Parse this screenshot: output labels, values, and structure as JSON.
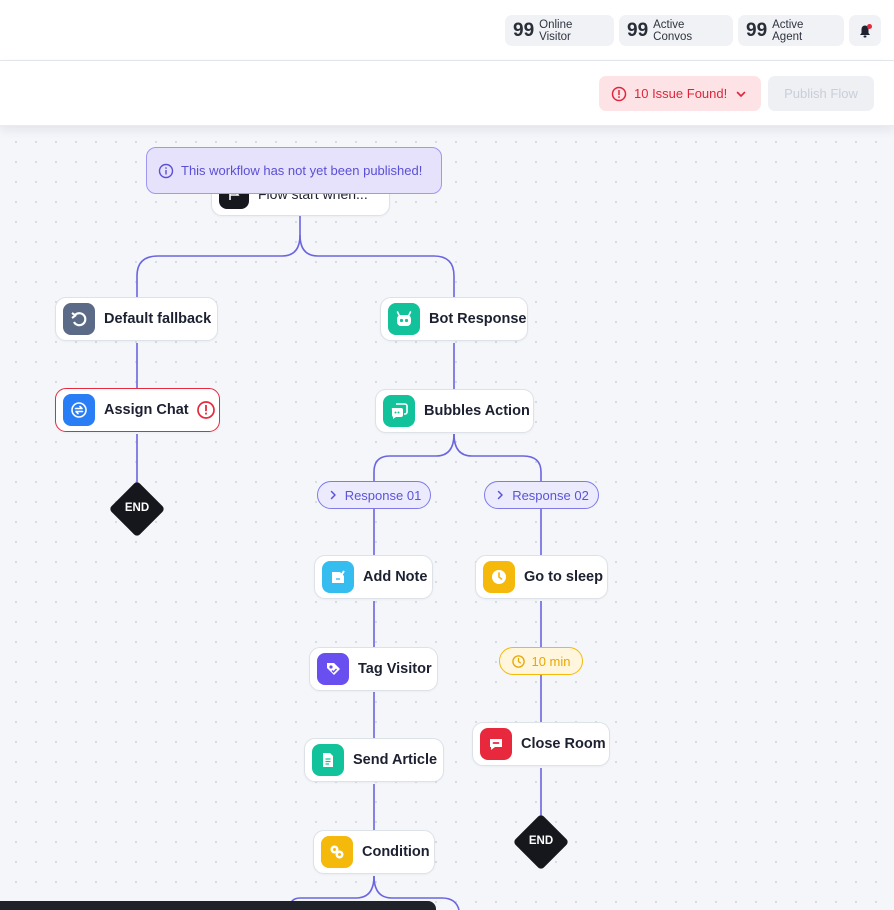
{
  "header": {
    "stats": [
      {
        "value": "99",
        "label": "Online Visitor"
      },
      {
        "value": "99",
        "label": "Active Convos"
      },
      {
        "value": "99",
        "label": "Active Agent"
      }
    ],
    "bell_icon": "bell-icon"
  },
  "toolbar": {
    "issues_label": "10 Issue Found!",
    "publish_label": "Publish Flow"
  },
  "flow": {
    "banner": "This workflow has not yet been published!",
    "start_label": "Flow start when...",
    "nodes": {
      "default_fallback": "Default fallback",
      "assign_chat": "Assign Chat",
      "bot_response": "Bot Response",
      "bubbles_action": "Bubbles Action",
      "add_note": "Add Note",
      "tag_visitor": "Tag Visitor",
      "send_article": "Send Article",
      "condition": "Condition",
      "go_to_sleep": "Go to sleep",
      "close_room": "Close Room"
    },
    "responses": [
      "Response 01",
      "Response 02"
    ],
    "sleep_duration": "10 min",
    "end_label": "END"
  },
  "colors": {
    "connector": "#6b66e0",
    "error": "#e8283c",
    "accent": "#5a54d8"
  }
}
